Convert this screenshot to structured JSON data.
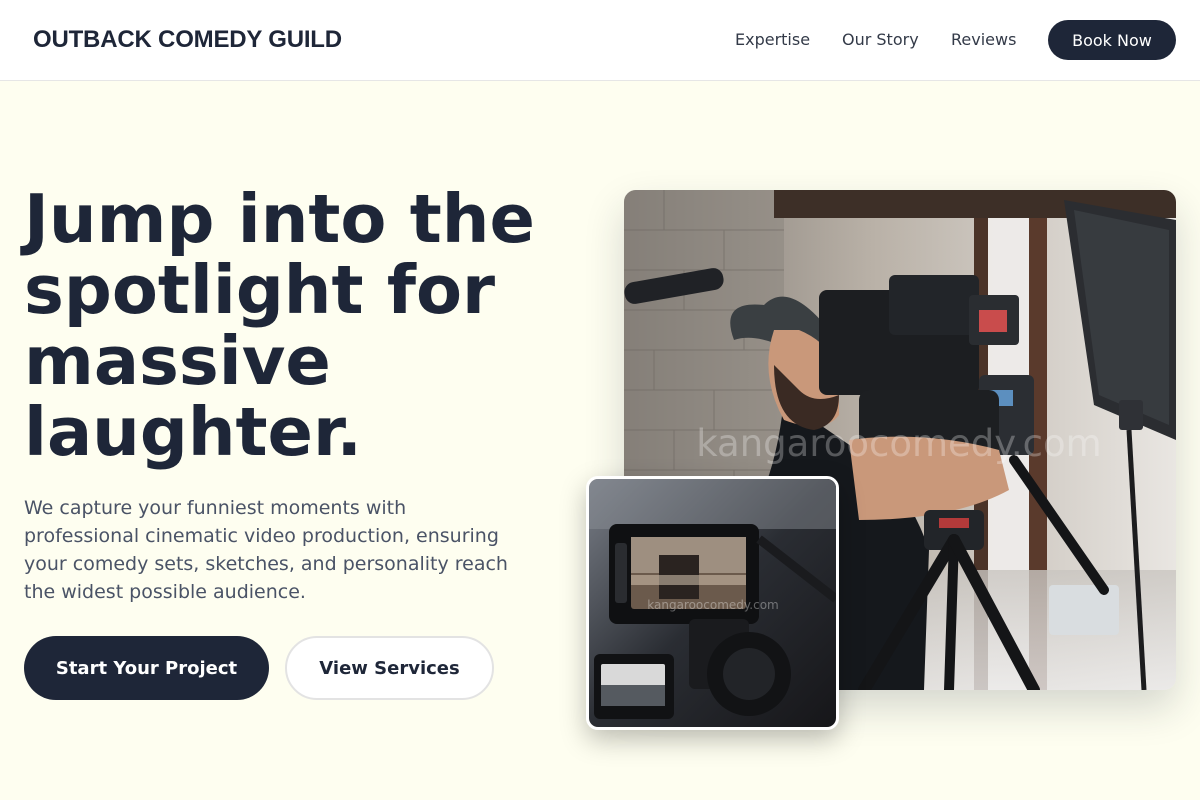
{
  "header": {
    "brand": "OUTBACK COMEDY GUILD",
    "nav": [
      "Expertise",
      "Our Story",
      "Reviews"
    ],
    "cta": "Book Now"
  },
  "hero": {
    "headline_lines": [
      "Jump into the",
      "spotlight for",
      "massive",
      "laughter."
    ],
    "subtext_lines": [
      "We capture your funniest moments with",
      "professional cinematic video production, ensuring",
      "your comedy sets, sketches, and personality reach",
      "the widest possible audience."
    ],
    "primary_cta": "Start Your Project",
    "secondary_cta": "View Services"
  },
  "images": {
    "main_watermark": "kangaroocomedy.com",
    "inset_watermark": "kangaroocomedy.com"
  },
  "colors": {
    "page_background": "#fefef0",
    "navy": "#1e2638",
    "body_text": "#4a5366"
  }
}
